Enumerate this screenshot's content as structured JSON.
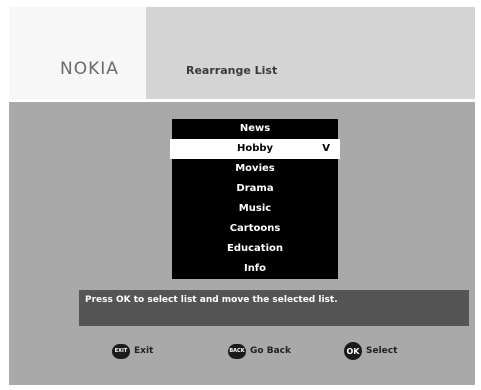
{
  "header": {
    "logo": "NOKIA",
    "title": "Rearrange List"
  },
  "list": {
    "items": [
      {
        "label": "News"
      },
      {
        "label": "Hobby",
        "selected": true,
        "mark": "V"
      },
      {
        "label": "Movies"
      },
      {
        "label": "Drama"
      },
      {
        "label": "Music"
      },
      {
        "label": "Cartoons"
      },
      {
        "label": "Education"
      },
      {
        "label": "Info"
      }
    ]
  },
  "message": "Press OK to select list and move the selected list.",
  "footer": {
    "exit": {
      "key": "EXIT",
      "label": "Exit"
    },
    "back": {
      "key": "BACK",
      "label": "Go Back"
    },
    "select": {
      "key": "OK",
      "label": "Select"
    }
  }
}
